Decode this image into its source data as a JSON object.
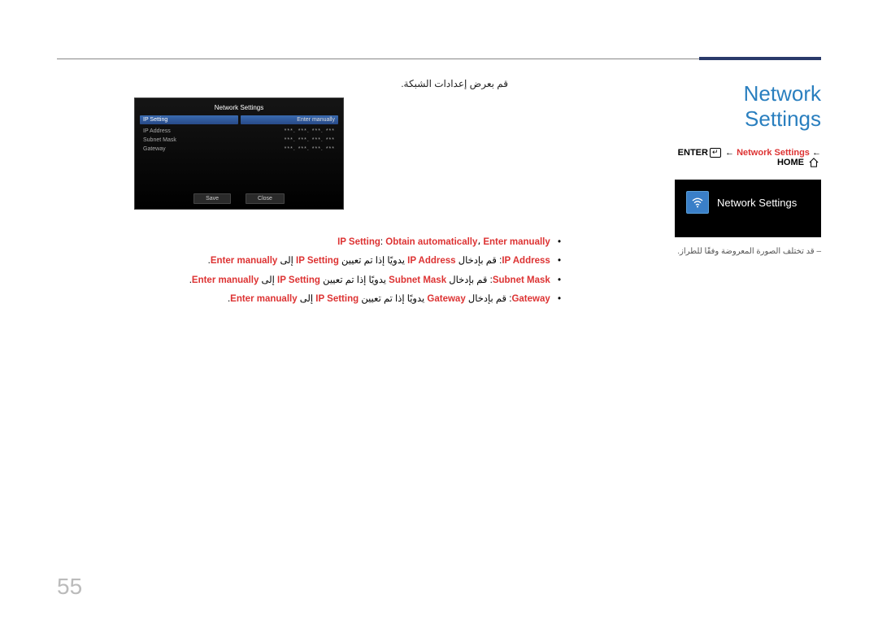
{
  "title_main": "Network Settings",
  "path": {
    "enter": "ENTER",
    "network_settings": "Network Settings",
    "home": "HOME",
    "arrow": "←"
  },
  "widget": {
    "label": "Network Settings"
  },
  "disclaimer": "– قد تختلف الصورة المعروضة وفقًا للطراز.",
  "caption_ar": "قم بعرض إعدادات الشبكة.",
  "tv": {
    "title": "Network Settings",
    "tab_left": "IP Setting",
    "tab_right": "Enter manually",
    "rows": [
      {
        "label": "IP Address",
        "value": "***. ***. ***. ***"
      },
      {
        "label": "Subnet Mask",
        "value": "***. ***. ***. ***"
      },
      {
        "label": "Gateway",
        "value": "***. ***. ***. ***"
      }
    ],
    "btn_save": "Save",
    "btn_close": "Close"
  },
  "bullets": {
    "b1": {
      "key": "IP Setting",
      "sep": ": ",
      "v1": "Obtain automatically",
      "comma": "، ",
      "v2": "Enter manually"
    },
    "b2": {
      "key": "IP Address",
      "t1": ": قم بإدخال ",
      "v1": "IP Address",
      "t2": " يدويًا إذا تم تعيين ",
      "v2": "IP Setting",
      "t3": " إلى ",
      "v3": "Enter manually",
      "dot": "."
    },
    "b3": {
      "key": "Subnet Mask",
      "t1": ": قم بإدخال ",
      "v1": "Subnet Mask",
      "t2": " يدويًا إذا تم تعيين ",
      "v2": "IP Setting",
      "t3": " إلى ",
      "v3": "Enter manually",
      "dot": "."
    },
    "b4": {
      "key": "Gateway",
      "t1": ": قم بإدخال ",
      "v1": "Gateway",
      "t2": " يدويًا إذا تم تعيين ",
      "v2": "IP Setting",
      "t3": " إلى ",
      "v3": "Enter manually",
      "dot": "."
    }
  },
  "page_number": "55"
}
